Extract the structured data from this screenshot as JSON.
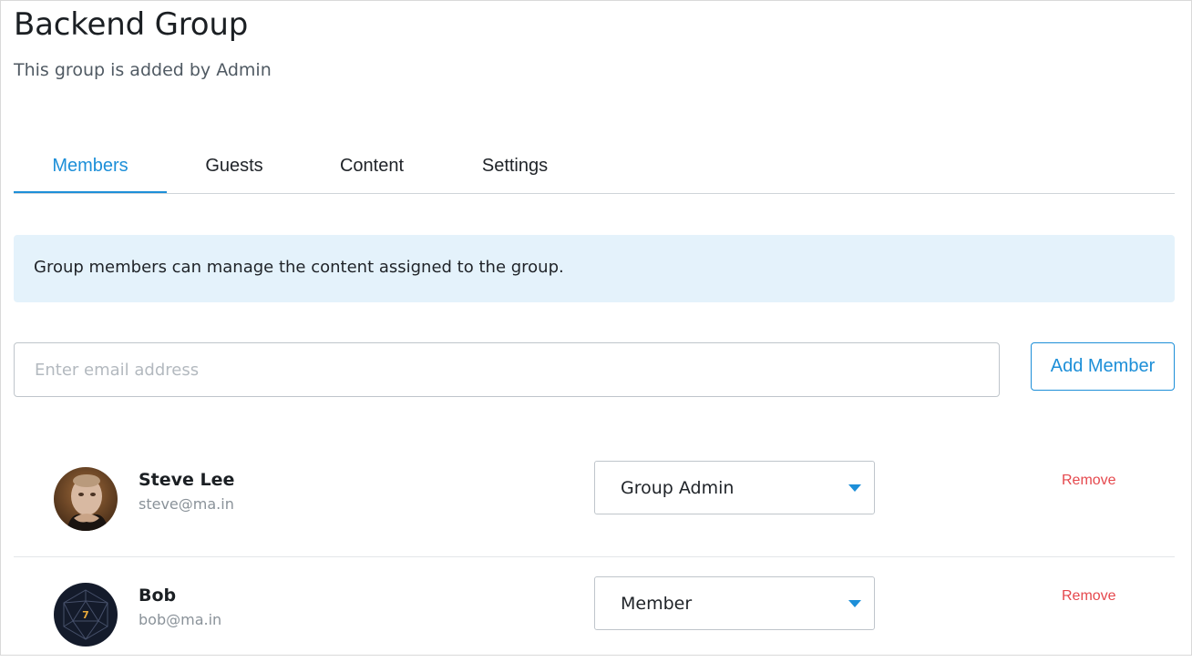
{
  "header": {
    "title": "Backend Group",
    "subtitle": "This group is added by Admin"
  },
  "tabs": [
    {
      "label": "Members",
      "active": true
    },
    {
      "label": "Guests",
      "active": false
    },
    {
      "label": "Content",
      "active": false
    },
    {
      "label": "Settings",
      "active": false
    }
  ],
  "info_banner": {
    "text": "Group members can manage the content assigned to the group."
  },
  "add_member": {
    "placeholder": "Enter email address",
    "value": "",
    "button_label": "Add Member"
  },
  "members": [
    {
      "name": "Steve Lee",
      "email": "steve@ma.in",
      "role": "Group Admin",
      "remove_label": "Remove",
      "avatar": "photo-avatar"
    },
    {
      "name": "Bob",
      "email": "bob@ma.in",
      "role": "Member",
      "remove_label": "Remove",
      "avatar": "d20-dice-avatar"
    }
  ],
  "colors": {
    "accent": "#1d8fd8",
    "danger": "#e5484d",
    "banner_bg": "#e4f2fb"
  }
}
